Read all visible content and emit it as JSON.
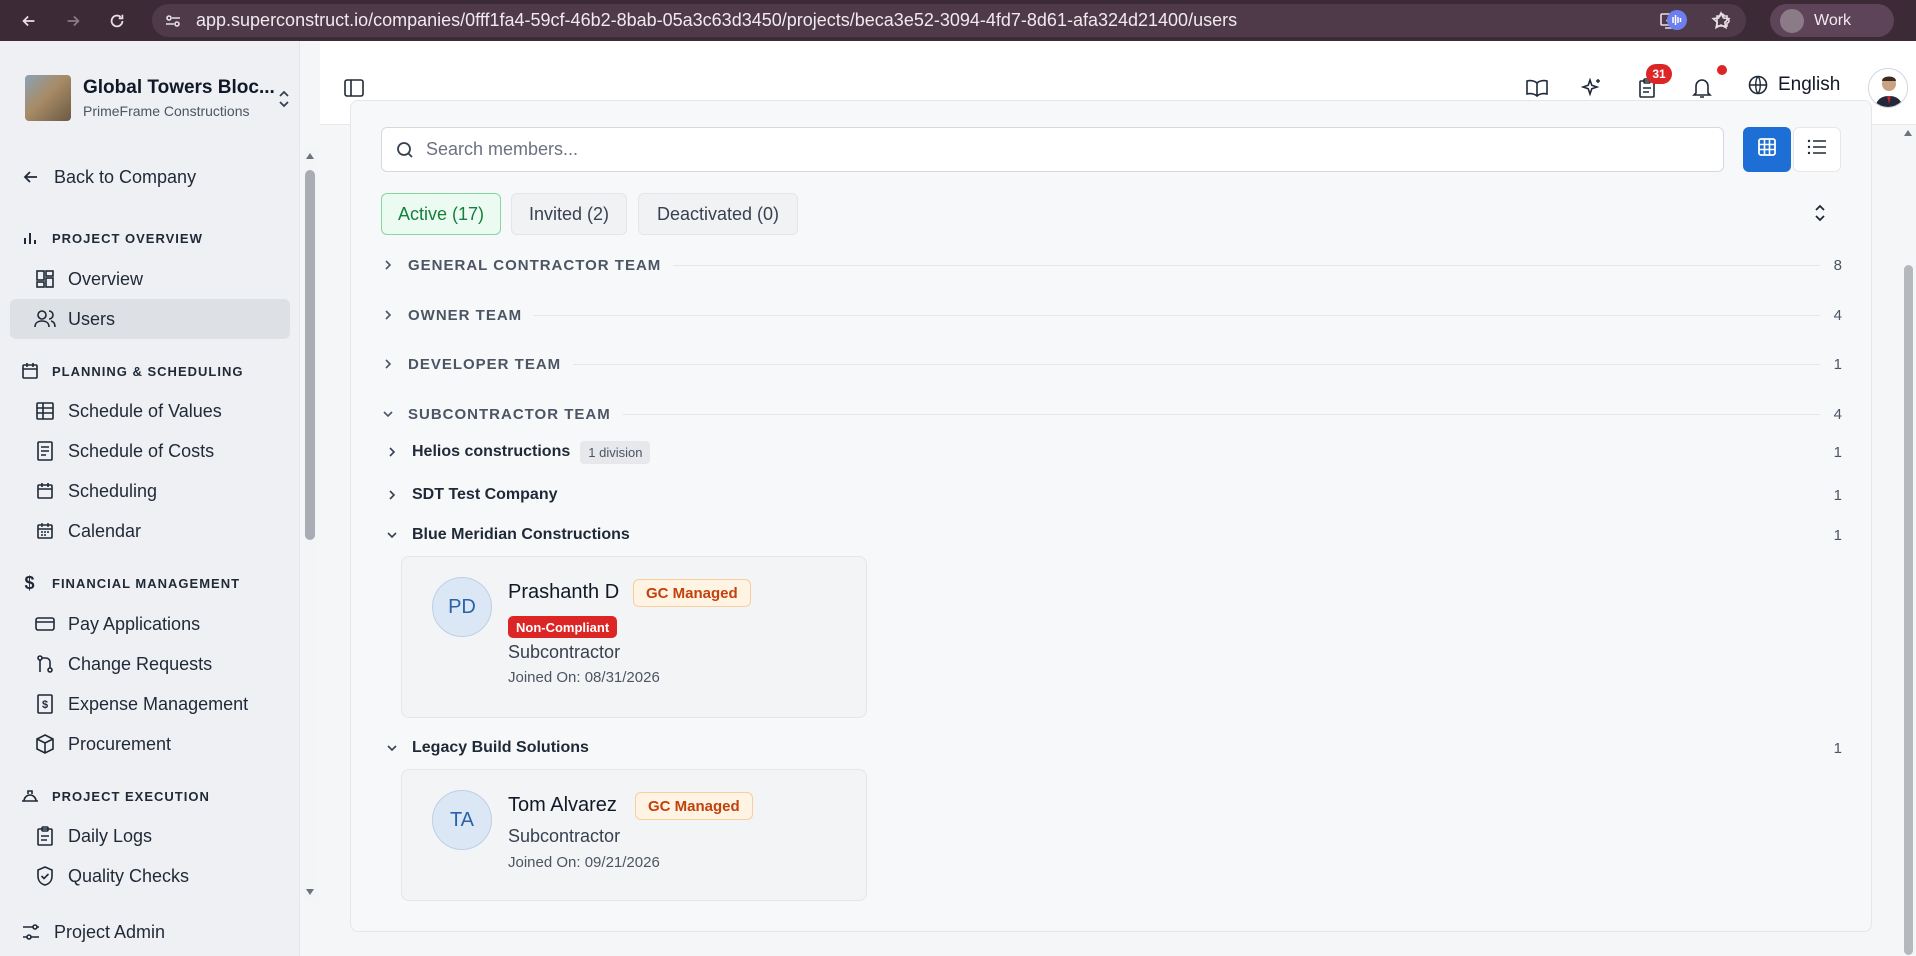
{
  "browser": {
    "url": "app.superconstruct.io/companies/0fff1fa4-59cf-46b2-8bab-05a3c63d3450/projects/beca3e52-3094-4fd7-8d61-afa324d21400/users",
    "profile_label": "Work"
  },
  "sidebar": {
    "project_name": "Global Towers Bloc...",
    "company_name": "PrimeFrame Constructions",
    "back_label": "Back to Company",
    "sections": {
      "project_overview": "PROJECT OVERVIEW",
      "planning": "PLANNING & SCHEDULING",
      "financial": "FINANCIAL MANAGEMENT",
      "execution": "PROJECT EXECUTION"
    },
    "items": {
      "overview": "Overview",
      "users": "Users",
      "schedule_values": "Schedule of Values",
      "schedule_costs": "Schedule of Costs",
      "scheduling": "Scheduling",
      "calendar": "Calendar",
      "pay_applications": "Pay Applications",
      "change_requests": "Change Requests",
      "expense_management": "Expense Management",
      "procurement": "Procurement",
      "daily_logs": "Daily Logs",
      "quality_checks": "Quality Checks",
      "project_admin": "Project Admin"
    }
  },
  "header": {
    "task_badge": "31",
    "language": "English"
  },
  "search": {
    "placeholder": "Search members..."
  },
  "tabs": {
    "active": "Active (17)",
    "invited": "Invited (2)",
    "deactivated": "Deactivated (0)"
  },
  "groups": {
    "gc": {
      "title": "GENERAL CONTRACTOR TEAM",
      "count": "8"
    },
    "owner": {
      "title": "OWNER TEAM",
      "count": "4"
    },
    "developer": {
      "title": "DEVELOPER TEAM",
      "count": "1"
    },
    "sub": {
      "title": "SUBCONTRACTOR TEAM",
      "count": "4"
    }
  },
  "companies": {
    "helios": {
      "name": "Helios constructions",
      "badge": "1 division",
      "count": "1"
    },
    "sdt": {
      "name": "SDT Test Company",
      "count": "1"
    },
    "blue": {
      "name": "Blue Meridian Constructions",
      "count": "1"
    },
    "legacy": {
      "name": "Legacy Build Solutions",
      "count": "1"
    }
  },
  "members": {
    "pd": {
      "initials": "PD",
      "name": "Prashanth D",
      "tag": "GC Managed",
      "compliance": "Non-Compliant",
      "role": "Subcontractor",
      "joined": "Joined On: 08/31/2026"
    },
    "ta": {
      "initials": "TA",
      "name": "Tom Alvarez",
      "tag": "GC Managed",
      "role": "Subcontractor",
      "joined": "Joined On: 09/21/2026"
    }
  }
}
